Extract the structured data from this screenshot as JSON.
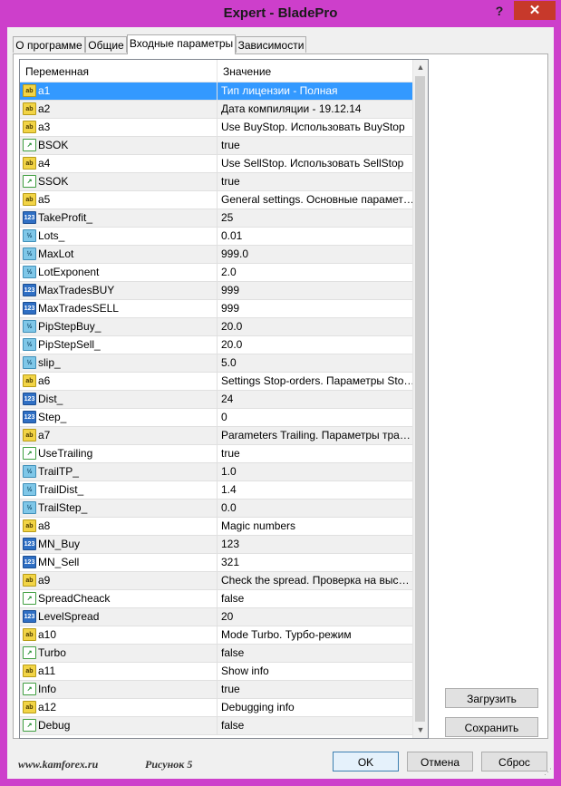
{
  "window": {
    "title": "Expert - BladePro",
    "help_label": "?",
    "close_label": "✕"
  },
  "tabs": [
    {
      "label": "О программе"
    },
    {
      "label": "Общие"
    },
    {
      "label": "Входные параметры"
    },
    {
      "label": "Зависимости"
    }
  ],
  "grid": {
    "col_name": "Переменная",
    "col_value": "Значение",
    "rows": [
      {
        "type": "ab",
        "name": "a1",
        "value": "Тип лицензии - Полная"
      },
      {
        "type": "ab",
        "name": "a2",
        "value": "Дата компиляции - 19.12.14"
      },
      {
        "type": "ab",
        "name": "a3",
        "value": "Use BuyStop. Использовать BuyStop"
      },
      {
        "type": "bool",
        "name": "BSOK",
        "value": "true"
      },
      {
        "type": "ab",
        "name": "a4",
        "value": "Use SellStop. Использовать SellStop"
      },
      {
        "type": "bool",
        "name": "SSOK",
        "value": "true"
      },
      {
        "type": "ab",
        "name": "a5",
        "value": "General settings. Основные параметры"
      },
      {
        "type": "123",
        "name": "TakeProfit_",
        "value": "25"
      },
      {
        "type": "v2",
        "name": "Lots_",
        "value": "0.01"
      },
      {
        "type": "v2",
        "name": "MaxLot",
        "value": "999.0"
      },
      {
        "type": "v2",
        "name": "LotExponent",
        "value": "2.0"
      },
      {
        "type": "123",
        "name": "MaxTradesBUY",
        "value": "999"
      },
      {
        "type": "123",
        "name": "MaxTradesSELL",
        "value": "999"
      },
      {
        "type": "v2",
        "name": "PipStepBuy_",
        "value": "20.0"
      },
      {
        "type": "v2",
        "name": "PipStepSell_",
        "value": "20.0"
      },
      {
        "type": "v2",
        "name": "slip_",
        "value": "5.0"
      },
      {
        "type": "ab",
        "name": "a6",
        "value": "Settings Stop-orders. Параметры Stop-op..."
      },
      {
        "type": "123",
        "name": "Dist_",
        "value": "24"
      },
      {
        "type": "123",
        "name": "Step_",
        "value": "0"
      },
      {
        "type": "ab",
        "name": "a7",
        "value": "Parameters Trailing. Параметры тралла"
      },
      {
        "type": "bool",
        "name": "UseTrailing",
        "value": "true"
      },
      {
        "type": "v2",
        "name": "TrailTP_",
        "value": "1.0"
      },
      {
        "type": "v2",
        "name": "TrailDist_",
        "value": "1.4"
      },
      {
        "type": "v2",
        "name": "TrailStep_",
        "value": "0.0"
      },
      {
        "type": "ab",
        "name": "a8",
        "value": "Magic numbers"
      },
      {
        "type": "123",
        "name": "MN_Buy",
        "value": "123"
      },
      {
        "type": "123",
        "name": "MN_Sell",
        "value": "321"
      },
      {
        "type": "ab",
        "name": "a9",
        "value": "Check the spread. Проверка на высокий..."
      },
      {
        "type": "bool",
        "name": "SpreadCheack",
        "value": "false"
      },
      {
        "type": "123",
        "name": "LevelSpread",
        "value": "20"
      },
      {
        "type": "ab",
        "name": "a10",
        "value": "Mode Turbo. Турбо-режим"
      },
      {
        "type": "bool",
        "name": "Turbo",
        "value": "false"
      },
      {
        "type": "ab",
        "name": "a11",
        "value": "Show info"
      },
      {
        "type": "bool",
        "name": "Info",
        "value": "true"
      },
      {
        "type": "ab",
        "name": "a12",
        "value": "Debugging info"
      },
      {
        "type": "bool",
        "name": "Debug",
        "value": "false"
      }
    ]
  },
  "icon_glyphs": {
    "ab": "ab",
    "123": "123",
    "v2": "½",
    "bool": "↗"
  },
  "buttons": {
    "load": "Загрузить",
    "save": "Сохранить",
    "ok": "OK",
    "cancel": "Отмена",
    "reset": "Сброс"
  },
  "footer": {
    "site": "www.kamforex.ru",
    "caption": "Рисунок 5"
  },
  "colors": {
    "titlebar": "#cd3fcb",
    "close": "#c7392b",
    "selection": "#3399ff"
  }
}
